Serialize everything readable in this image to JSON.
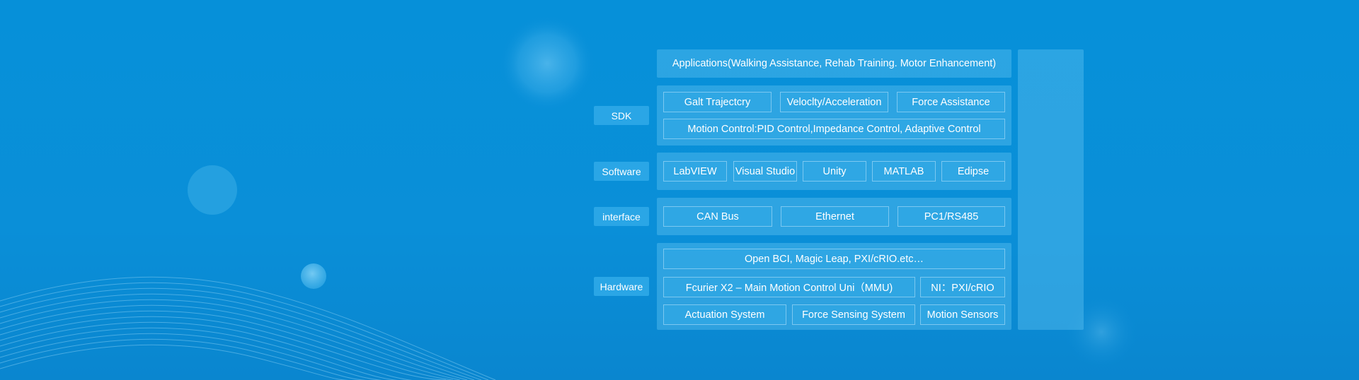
{
  "applications": "Applications(Walking Assistance, Rehab Training. Motor Enhancement)",
  "sdk": {
    "label": "SDK",
    "items": [
      "Galt Trajectcry",
      "Veloclty/Acceleration",
      "Force Assistance"
    ],
    "motion_control": "Motion Control:PID Control,Impedance Control, Adaptive Control"
  },
  "software": {
    "label": "Software",
    "items": [
      "LabVIEW",
      "Visual Studio",
      "Unity",
      "MATLAB",
      "Edipse"
    ]
  },
  "interface": {
    "label": "interface",
    "items": [
      "CAN Bus",
      "Ethernet",
      "PC1/RS485"
    ]
  },
  "hardware": {
    "label": "Hardware",
    "open": "Open BCI, Magic Leap, PXI/cRIO.etc…",
    "main": "Fcurier X2 – Main Motion Control Uni（MMU)",
    "ni": "NI：PXI/cRIO",
    "bottom": [
      "Actuation System",
      "Force Sensing System",
      "Motion Sensors"
    ]
  },
  "colors": {
    "background": "#0a8fd8",
    "label_bg": "#2aa6e6",
    "text": "#ffffff"
  }
}
